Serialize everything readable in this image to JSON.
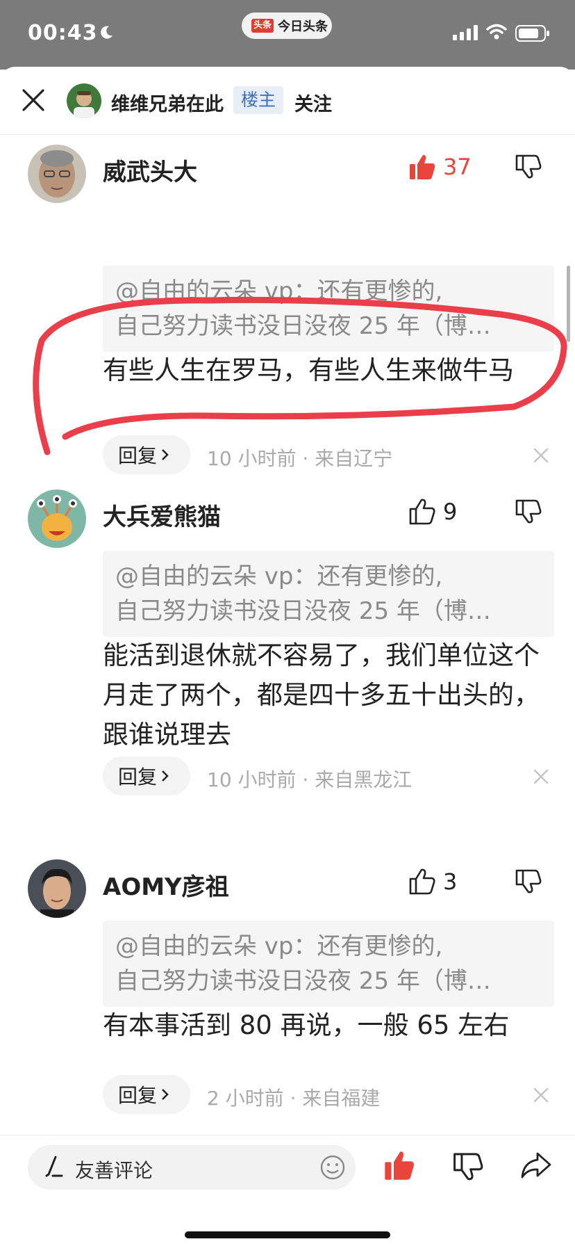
{
  "status_bar": {
    "time": "00:43"
  },
  "app": {
    "logo_text": "头条",
    "name": "今日头条"
  },
  "header": {
    "host_name": "维维兄弟在此",
    "host_tag": "楼主",
    "follow_label": "关注"
  },
  "comments": [
    {
      "username": "威武头大",
      "likes": "37",
      "liked": true,
      "quote_line1": "@自由的云朵 vp：还有更惨的,",
      "quote_line2": "自己努力读书没日没夜 25 年（博…",
      "text": "有些人生在罗马，有些人生来做牛马",
      "reply_label": "回复",
      "meta": "10 小时前 · 来自辽宁"
    },
    {
      "username": "大兵爱熊猫",
      "likes": "9",
      "liked": false,
      "quote_line1": "@自由的云朵 vp：还有更惨的,",
      "quote_line2": "自己努力读书没日没夜 25 年（博…",
      "text": "能活到退休就不容易了，我们单位这个月走了两个，都是四十多五十出头的，跟谁说理去",
      "reply_label": "回复",
      "meta": "10 小时前 · 来自黑龙江"
    },
    {
      "username": "AOMY彦祖",
      "likes": "3",
      "liked": false,
      "quote_line1": "@自由的云朵 vp：还有更惨的,",
      "quote_line2": "自己努力读书没日没夜 25 年（博…",
      "text": "有本事活到 80 再说，一般 65 左右",
      "reply_label": "回复",
      "meta": "2 小时前 · 来自福建"
    }
  ],
  "bottom_bar": {
    "comment_placeholder": "友善评论"
  },
  "colors": {
    "accent_red": "#e8453c",
    "tag_blue": "#3d6fc4",
    "status_gray": "#7b7b7b"
  },
  "icons": [
    "close-icon",
    "thumbs-up-icon",
    "thumbs-down-icon",
    "chevron-right-icon",
    "dismiss-icon",
    "pen-icon",
    "emoji-icon",
    "share-icon",
    "moon-icon",
    "signal-icon",
    "wifi-icon",
    "battery-icon"
  ]
}
